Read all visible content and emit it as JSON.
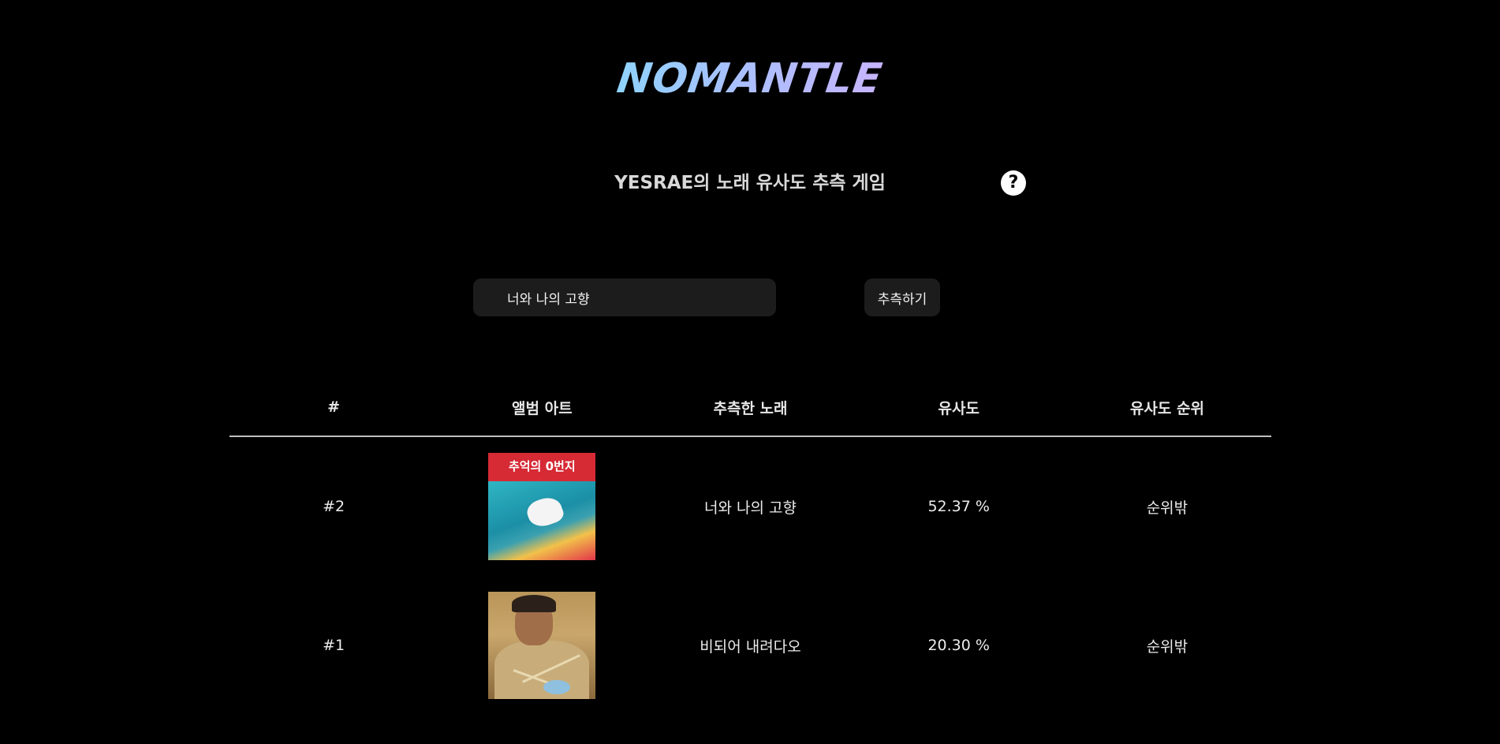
{
  "app": {
    "logo": "NOMANTLE",
    "subtitle": "YESRAE의 노래 유사도 추측 게임",
    "help_icon": "question-circle-icon",
    "help_label": "?"
  },
  "guess": {
    "input_value": "너와 나의 고향",
    "button_label": "추측하기"
  },
  "table": {
    "headers": [
      "#",
      "앨범 아트",
      "추측한 노래",
      "유사도",
      "유사도 순위"
    ],
    "rows": [
      {
        "number": "#2",
        "album_art_text": "추억의 0번지",
        "song": "너와 나의 고향",
        "similarity": "52.37 %",
        "rank": "순위밖"
      },
      {
        "number": "#1",
        "album_art_text": "",
        "song": "비되어 내려다오",
        "similarity": "20.30 %",
        "rank": "순위밖"
      }
    ]
  },
  "colors": {
    "background": "#000000",
    "logo_gradient_start": "#8fd3fe",
    "logo_gradient_end": "#c7b4ff",
    "input_bg": "#1c1c1c",
    "divider": "#bfbfbf"
  }
}
